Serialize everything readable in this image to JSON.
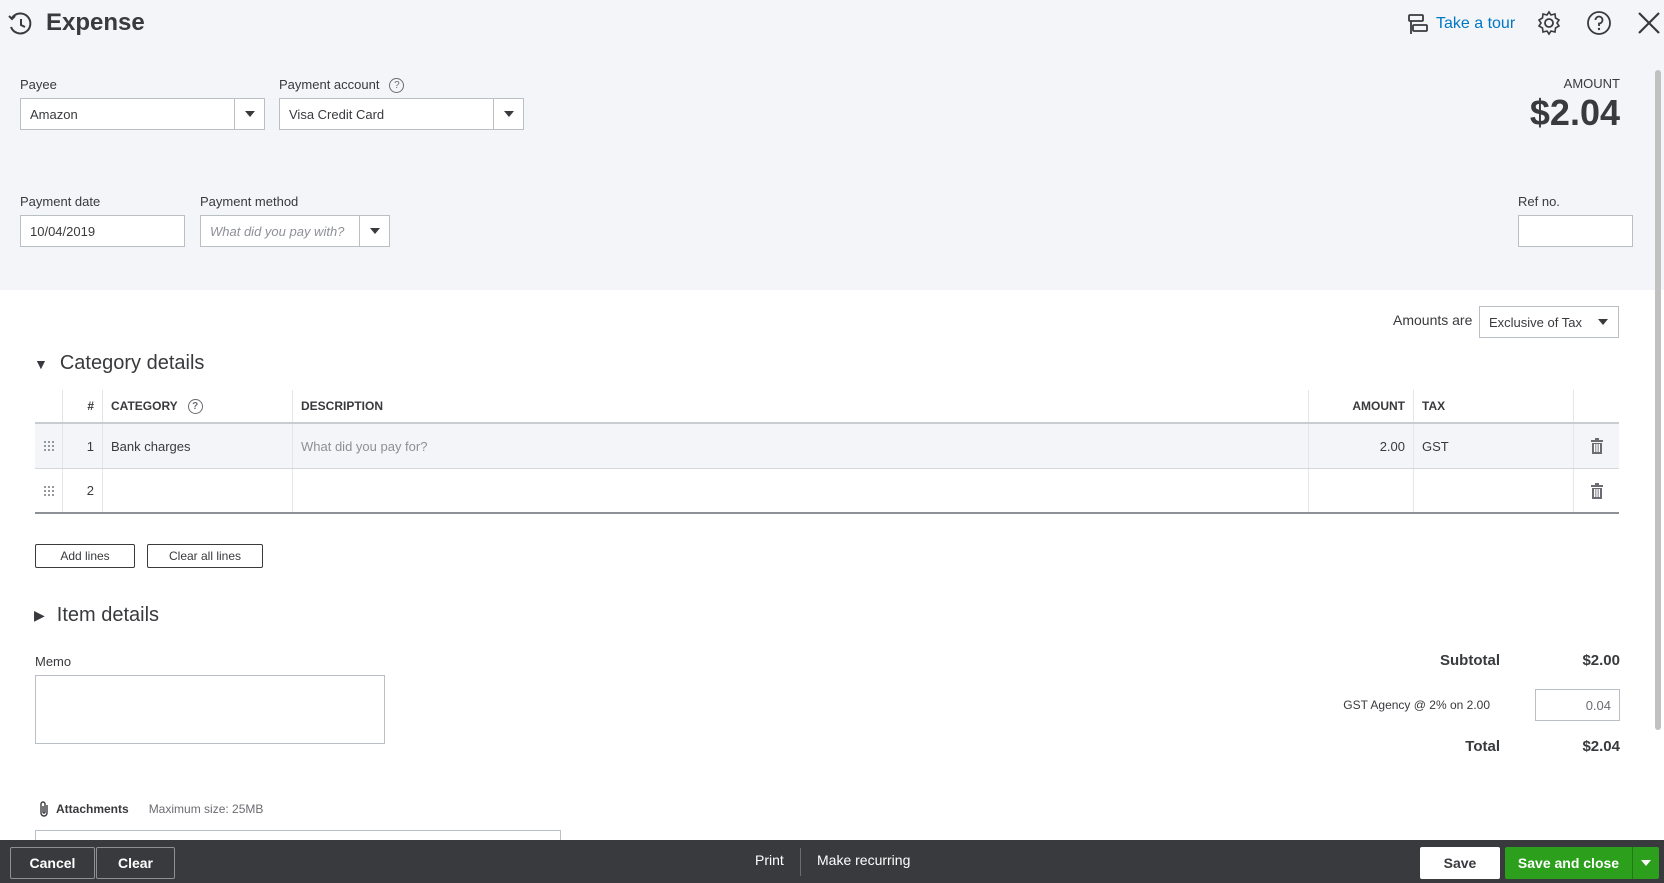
{
  "header": {
    "title": "Expense",
    "take_tour": "Take a tour"
  },
  "form": {
    "payee_label": "Payee",
    "payee_value": "Amazon",
    "payment_account_label": "Payment account",
    "payment_account_value": "Visa Credit Card",
    "payment_date_label": "Payment date",
    "payment_date_value": "10/04/2019",
    "payment_method_label": "Payment method",
    "payment_method_placeholder": "What did you pay with?",
    "ref_no_label": "Ref no.",
    "ref_no_value": "",
    "amount_label": "AMOUNT",
    "amount_value": "$2.04"
  },
  "tax_setting": {
    "label": "Amounts are",
    "value": "Exclusive of Tax"
  },
  "category_details": {
    "title": "Category details",
    "columns": {
      "num": "#",
      "category": "CATEGORY",
      "description": "DESCRIPTION",
      "amount": "AMOUNT",
      "tax": "TAX"
    },
    "rows": [
      {
        "num": "1",
        "category": "Bank charges",
        "description_placeholder": "What did you pay for?",
        "amount": "2.00",
        "tax": "GST"
      },
      {
        "num": "2",
        "category": "",
        "description_placeholder": "",
        "amount": "",
        "tax": ""
      }
    ],
    "add_lines": "Add lines",
    "clear_all_lines": "Clear all lines"
  },
  "item_details": {
    "title": "Item details"
  },
  "memo": {
    "label": "Memo",
    "value": ""
  },
  "totals": {
    "subtotal_label": "Subtotal",
    "subtotal_value": "$2.00",
    "tax_label": "GST Agency @ 2% on 2.00",
    "tax_value": "0.04",
    "total_label": "Total",
    "total_value": "$2.04"
  },
  "attachments": {
    "label": "Attachments",
    "max_size": "Maximum size: 25MB"
  },
  "footer": {
    "cancel": "Cancel",
    "clear": "Clear",
    "print": "Print",
    "make_recurring": "Make recurring",
    "save": "Save",
    "save_and_close": "Save and close"
  },
  "colors": {
    "accent_green": "#2ca01c",
    "link_blue": "#0077c5",
    "footer_bg": "#393a3d",
    "header_bg": "#f4f5f8"
  },
  "icons": [
    "history-icon",
    "tour-icon",
    "gear-icon",
    "help-icon",
    "close-icon",
    "drag-handle-icon",
    "trash-icon",
    "paperclip-icon"
  ]
}
